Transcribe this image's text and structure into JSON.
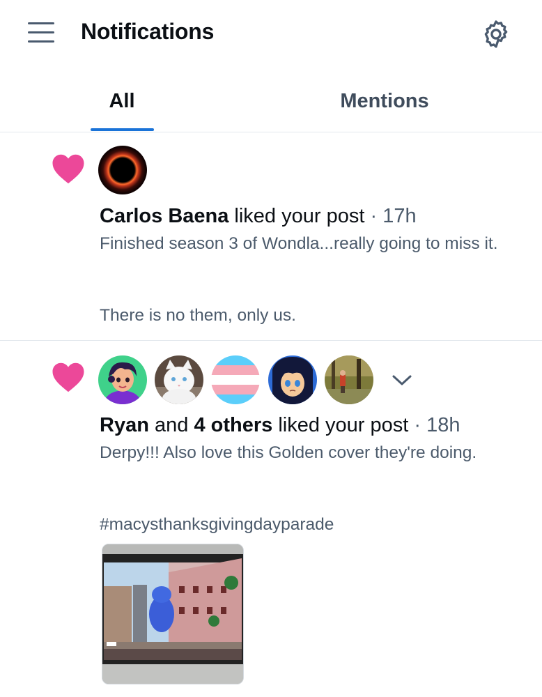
{
  "header": {
    "title": "Notifications",
    "menu_icon": "hamburger-menu-icon",
    "settings_icon": "gear-icon"
  },
  "tabs": [
    {
      "label": "All",
      "active": true
    },
    {
      "label": "Mentions",
      "active": false
    }
  ],
  "colors": {
    "accent": "#1a73d8",
    "like": "#ec4899",
    "muted_text": "#4b5a6b",
    "divider": "#e3e8ee"
  },
  "notifications": [
    {
      "icon": "heart-icon",
      "user": "Carlos Baena",
      "action": "liked your post",
      "separator": "·",
      "time": "17h",
      "text_line1": "Finished season 3 of Wondla...really going to miss it.",
      "text_line2": "There is no them, only us."
    },
    {
      "icon": "heart-icon",
      "user": "Ryan",
      "conjunction": "and",
      "others": "4 others",
      "action": "liked your post",
      "separator": "·",
      "time": "18h",
      "text_line1": "Derpy!!! Also love this Golden cover they're doing.",
      "text_line2": "#macysthanksgivingdayparade",
      "expand_icon": "chevron-down-icon"
    }
  ]
}
